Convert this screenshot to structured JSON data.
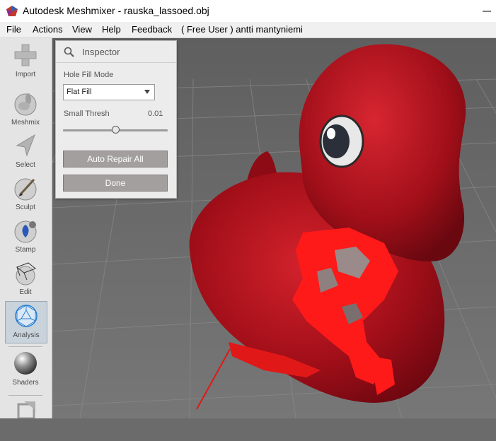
{
  "window": {
    "title": "Autodesk Meshmixer - rauska_lassoed.obj"
  },
  "menu": {
    "items": [
      "File",
      "Actions",
      "View",
      "Help",
      "Feedback",
      "( Free User ) antti mantyniemi"
    ]
  },
  "toolbar": {
    "tools": [
      {
        "label": "Import",
        "icon": "plus-icon"
      },
      {
        "label": "Meshmix",
        "icon": "bunny-sphere-icon"
      },
      {
        "label": "Select",
        "icon": "arrow-cursor-icon"
      },
      {
        "label": "Sculpt",
        "icon": "brush-sphere-icon"
      },
      {
        "label": "Stamp",
        "icon": "stamp-sphere-icon"
      },
      {
        "label": "Edit",
        "icon": "wire-cube-sphere-icon"
      },
      {
        "label": "Analysis",
        "icon": "geodesic-sphere-icon"
      },
      {
        "label": "Shaders",
        "icon": "chrome-sphere-icon"
      }
    ],
    "active": "Analysis"
  },
  "inspector": {
    "title": "Inspector",
    "hole_fill_mode_label": "Hole Fill Mode",
    "hole_fill_mode_value": "Flat Fill",
    "small_thresh_label": "Small Thresh",
    "small_thresh_value": "0.01",
    "small_thresh_slider_fraction": 0.5,
    "auto_repair_label": "Auto Repair All",
    "done_label": "Done"
  },
  "colors": {
    "model_red": "#b4101b",
    "error_highlight": "#ff1a1a",
    "viewport_bg": "#6b6b6b",
    "button_gray": "#a39f9f"
  }
}
